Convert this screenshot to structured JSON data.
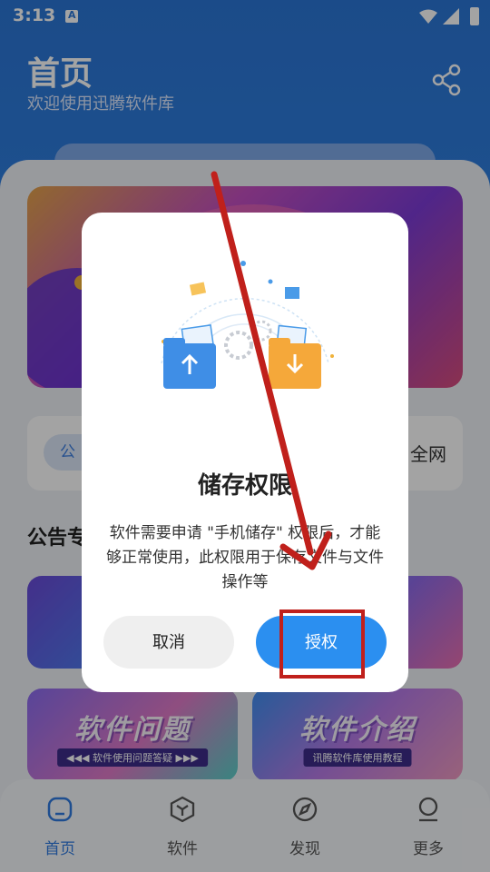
{
  "status_bar": {
    "time": "3:13"
  },
  "header": {
    "title": "首页",
    "subtitle": "欢迎使用迅腾软件库"
  },
  "notice": {
    "tag": "公",
    "tail": "全网"
  },
  "section": {
    "title": "公告专"
  },
  "tiles": [
    {
      "title": "",
      "subtitle": ""
    },
    {
      "title": "",
      "subtitle": ""
    },
    {
      "title": "软件问题",
      "subtitle": "◀◀◀ 软件使用问题答疑 ▶▶▶"
    },
    {
      "title": "软件介绍",
      "subtitle": "讯腾软件库使用教程"
    }
  ],
  "dialog": {
    "title": "储存权限",
    "message": "软件需要申请 \"手机储存\" 权限后，才能够正常使用，此权限用于保存文件与文件操作等",
    "cancel_label": "取消",
    "authorize_label": "授权"
  },
  "bottom_nav": [
    {
      "label": "首页",
      "icon": "home-icon",
      "active": true
    },
    {
      "label": "软件",
      "icon": "box-icon",
      "active": false
    },
    {
      "label": "发现",
      "icon": "compass-icon",
      "active": false
    },
    {
      "label": "更多",
      "icon": "user-icon",
      "active": false
    }
  ],
  "colors": {
    "primary": "#2b8ff0",
    "header": "#2b76d6",
    "annotation": "#c0201b"
  }
}
